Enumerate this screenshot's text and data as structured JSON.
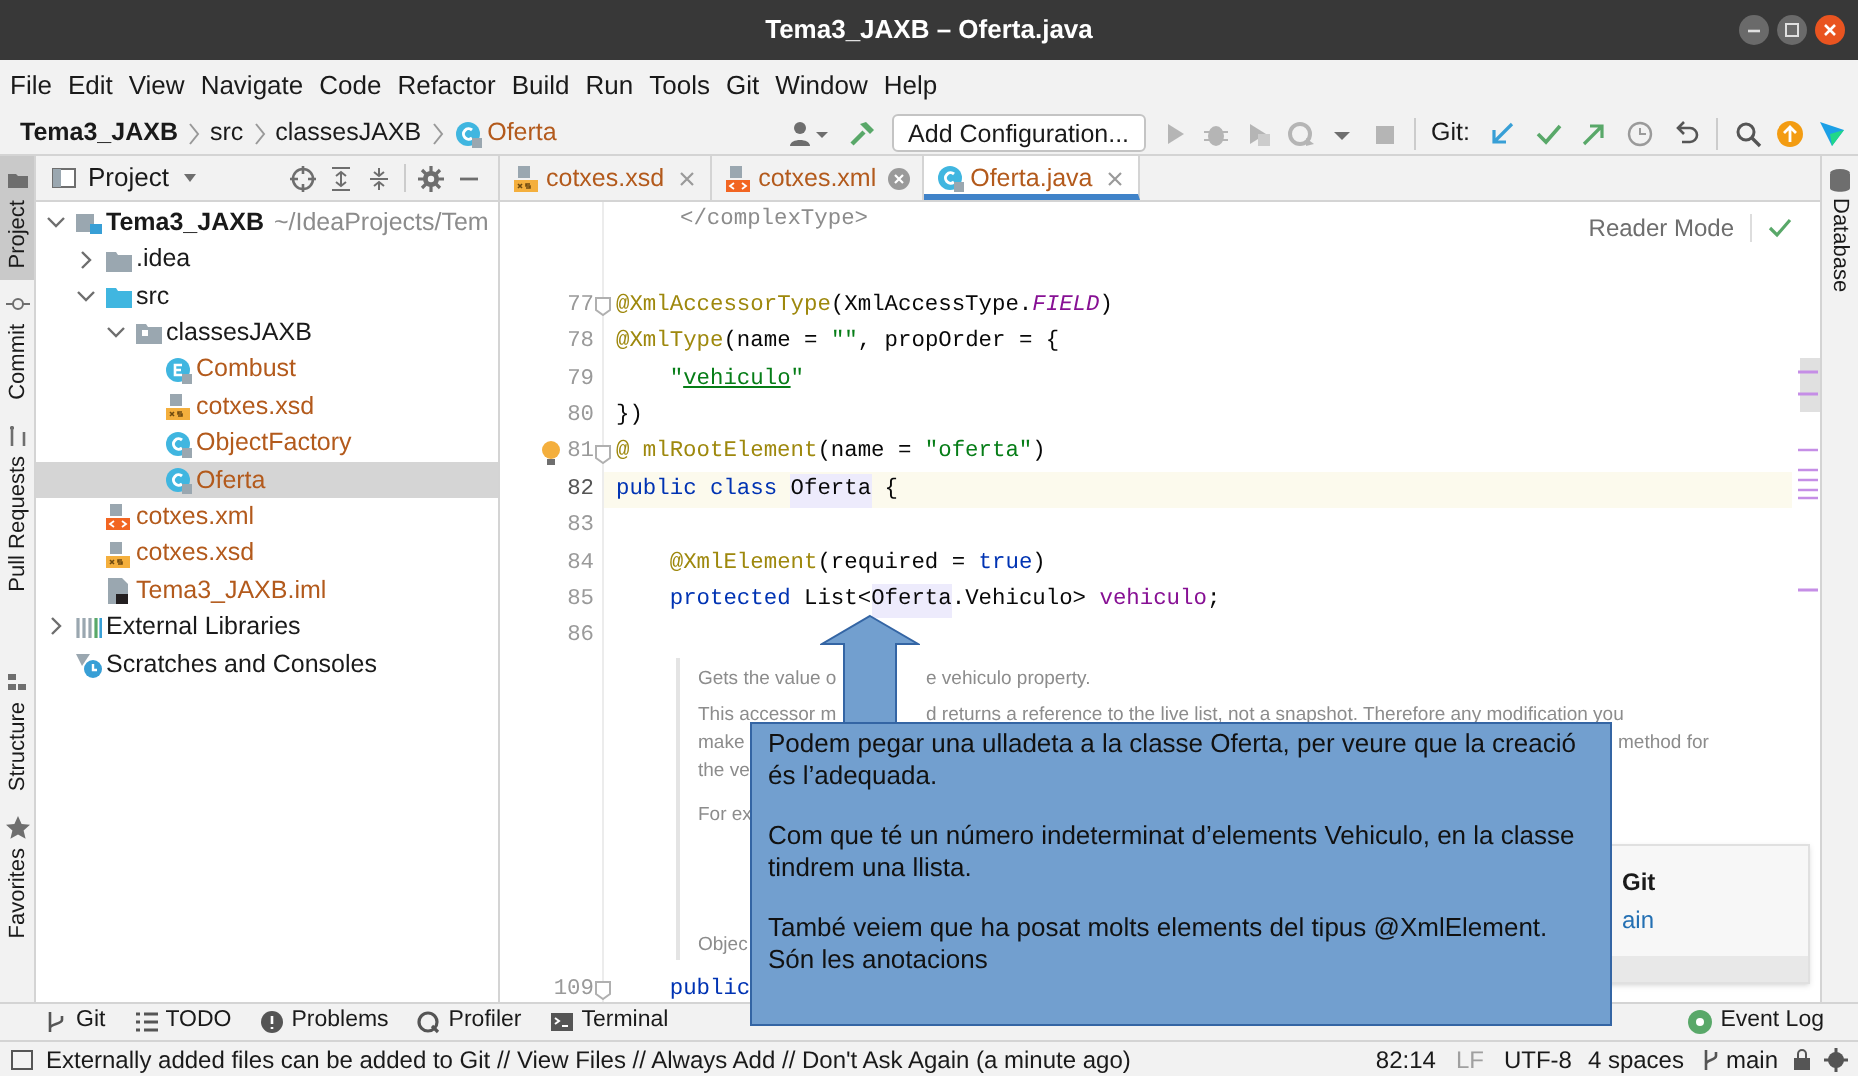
{
  "window": {
    "title": "Tema3_JAXB – Oferta.java"
  },
  "menu": [
    "File",
    "Edit",
    "View",
    "Navigate",
    "Code",
    "Refactor",
    "Build",
    "Run",
    "Tools",
    "Git",
    "Window",
    "Help"
  ],
  "breadcrumbs": [
    {
      "label": "Tema3_JAXB",
      "kind": "project"
    },
    {
      "label": "src",
      "kind": "folder"
    },
    {
      "label": "classesJAXB",
      "kind": "folder"
    },
    {
      "label": "Oferta",
      "kind": "class"
    }
  ],
  "toolbar": {
    "run_config": "Add Configuration...",
    "git_label": "Git:"
  },
  "tool_windows_left_top": [
    {
      "label": "Project",
      "selected": true
    },
    {
      "label": "Commit",
      "selected": false
    },
    {
      "label": "Pull Requests",
      "selected": false
    }
  ],
  "tool_windows_left_bottom": [
    {
      "label": "Structure",
      "selected": false
    },
    {
      "label": "Favorites",
      "selected": false
    }
  ],
  "tool_windows_right": [
    {
      "label": "Database",
      "selected": false
    }
  ],
  "project_panel": {
    "title": "Project",
    "tree": [
      {
        "label": "Tema3_JAXB",
        "hint": "~/IdeaProjects/Tem",
        "kind": "module",
        "untracked": false,
        "expanded": true,
        "selected": false,
        "children": [
          {
            "label": ".idea",
            "kind": "folder",
            "untracked": false,
            "expanded": false,
            "selected": false
          },
          {
            "label": "src",
            "kind": "source",
            "untracked": false,
            "expanded": true,
            "selected": false,
            "children": [
              {
                "label": "classesJAXB",
                "kind": "package",
                "untracked": false,
                "expanded": true,
                "selected": false,
                "children": [
                  {
                    "label": "Combust",
                    "kind": "enum",
                    "untracked": true,
                    "selected": false
                  },
                  {
                    "label": "cotxes.xsd",
                    "kind": "xsd",
                    "untracked": true,
                    "selected": false
                  },
                  {
                    "label": "ObjectFactory",
                    "kind": "class",
                    "untracked": true,
                    "selected": false
                  },
                  {
                    "label": "Oferta",
                    "kind": "class",
                    "untracked": true,
                    "selected": true
                  }
                ]
              }
            ]
          },
          {
            "label": "cotxes.xml",
            "kind": "xml",
            "untracked": true,
            "selected": false
          },
          {
            "label": "cotxes.xsd",
            "kind": "xsd",
            "untracked": true,
            "selected": false
          },
          {
            "label": "Tema3_JAXB.iml",
            "kind": "iml",
            "untracked": true,
            "selected": false
          }
        ]
      },
      {
        "label": "External Libraries",
        "kind": "libraries",
        "untracked": false,
        "expanded": false,
        "selected": false
      },
      {
        "label": "Scratches and Consoles",
        "kind": "scratches",
        "untracked": false,
        "selected": false
      }
    ]
  },
  "editor": {
    "tabs": [
      {
        "label": "cotxes.xsd",
        "kind": "xsd",
        "untracked": true,
        "selected": false,
        "hovered": false
      },
      {
        "label": "cotxes.xml",
        "kind": "xml",
        "untracked": true,
        "selected": false,
        "hovered": true
      },
      {
        "label": "Oferta.java",
        "kind": "class",
        "untracked": true,
        "selected": true,
        "hovered": false
      }
    ],
    "rendered_doc_top": "</complexType>",
    "reader_mode": "Reader Mode",
    "lines": [
      {
        "number": "77",
        "current": false,
        "fold": true,
        "bulb": false,
        "tokens": [
          {
            "text": "@XmlAccessorType",
            "kind": "ann"
          },
          {
            "text": "(XmlAccessType.",
            "kind": "plain"
          },
          {
            "text": "FIELD",
            "kind": "const"
          },
          {
            "text": ")",
            "kind": "plain"
          }
        ]
      },
      {
        "number": "78",
        "current": false,
        "fold": false,
        "bulb": false,
        "tokens": [
          {
            "text": "@XmlType",
            "kind": "ann"
          },
          {
            "text": "(name = ",
            "kind": "plain"
          },
          {
            "text": "\"\"",
            "kind": "str"
          },
          {
            "text": ", propOrder = {",
            "kind": "plain"
          }
        ]
      },
      {
        "number": "79",
        "current": false,
        "fold": false,
        "bulb": false,
        "tokens": [
          {
            "text": "    \"",
            "kind": "str"
          },
          {
            "text": "vehiculo",
            "kind": "ref"
          },
          {
            "text": "\"",
            "kind": "str"
          }
        ]
      },
      {
        "number": "80",
        "current": false,
        "fold": false,
        "bulb": false,
        "tokens": [
          {
            "text": "})",
            "kind": "plain"
          }
        ]
      },
      {
        "number": "81",
        "current": false,
        "fold": true,
        "bulb": true,
        "tokens": [
          {
            "text": "@",
            "kind": "ann"
          },
          {
            "text": "mlRootElement",
            "kind": "ann"
          },
          {
            "text": "(name = ",
            "kind": "plain"
          },
          {
            "text": "\"oferta\"",
            "kind": "str"
          },
          {
            "text": ")",
            "kind": "plain"
          }
        ]
      },
      {
        "number": "82",
        "current": true,
        "fold": false,
        "bulb": false,
        "tokens": [
          {
            "text": "public class ",
            "kind": "kw"
          },
          {
            "text": "Oferta",
            "kind": "usage"
          },
          {
            "text": " {",
            "kind": "plain"
          }
        ]
      },
      {
        "number": "83",
        "current": false,
        "fold": false,
        "bulb": false
      },
      {
        "number": "84",
        "current": false,
        "fold": false,
        "bulb": false,
        "tokens": [
          {
            "text": "    @XmlElement",
            "kind": "ann"
          },
          {
            "text": "(required = ",
            "kind": "plain"
          },
          {
            "text": "true",
            "kind": "kw"
          },
          {
            "text": ")",
            "kind": "plain"
          }
        ]
      },
      {
        "number": "85",
        "current": false,
        "fold": false,
        "bulb": false,
        "tokens": [
          {
            "text": "    protected ",
            "kind": "kw"
          },
          {
            "text": "List<",
            "kind": "plain"
          },
          {
            "text": "Oferta",
            "kind": "usage"
          },
          {
            "text": ".Vehiculo> ",
            "kind": "plain"
          },
          {
            "text": "vehiculo",
            "kind": "field"
          },
          {
            "text": ";",
            "kind": "plain"
          }
        ]
      },
      {
        "number": "86",
        "current": false,
        "fold": false,
        "bulb": false
      }
    ],
    "doc": [
      {
        "kind": "text",
        "lines": [
          {
            "left": "Gets the value o",
            "right": "e vehiculo property.",
            "kind": "arrow"
          }
        ]
      },
      {
        "kind": "text",
        "lines": [
          {
            "left": "This accessor m",
            "right": "d returns a reference to the live list, not a snapshot. Therefore any modification you",
            "kind": "arrow"
          },
          {
            "left": "make",
            "right": "method for",
            "kind": "callout"
          },
          {
            "left": "the ve"
          }
        ]
      },
      {
        "kind": "example",
        "lines": [
          {
            "left": "For ex"
          }
        ]
      },
      {
        "kind": "text",
        "lines": [
          {
            "left": "Objec"
          }
        ]
      }
    ],
    "tail_line": {
      "number": "109",
      "fold": true,
      "tokens": [
        {
          "text": "    public",
          "kind": "kw"
        }
      ]
    },
    "balloon": {
      "title": "Git",
      "link": "ain"
    }
  },
  "callout": {
    "paragraphs": [
      "Podem pegar una ulladeta a la classe Oferta, per veure que la creació és l’adequada.",
      "Com que té un número indeterminat d’elements Vehiculo, en la classe tindrem una llista.",
      "També veiem que ha posat molts elements del tipus @XmlElement. Són les anotacions"
    ]
  },
  "bottom_tools": [
    {
      "label": "Git"
    },
    {
      "label": "TODO"
    },
    {
      "label": "Problems"
    },
    {
      "label": "Profiler"
    },
    {
      "label": "Terminal"
    }
  ],
  "event_log": "Event Log",
  "status_bar": {
    "message": "Externally added files can be added to Git // View Files // Always Add // Don't Ask Again (a minute ago)",
    "position": "82:14",
    "line_separator": "LF",
    "encoding": "UTF-8",
    "indent": "4 spaces",
    "branch": "main"
  }
}
